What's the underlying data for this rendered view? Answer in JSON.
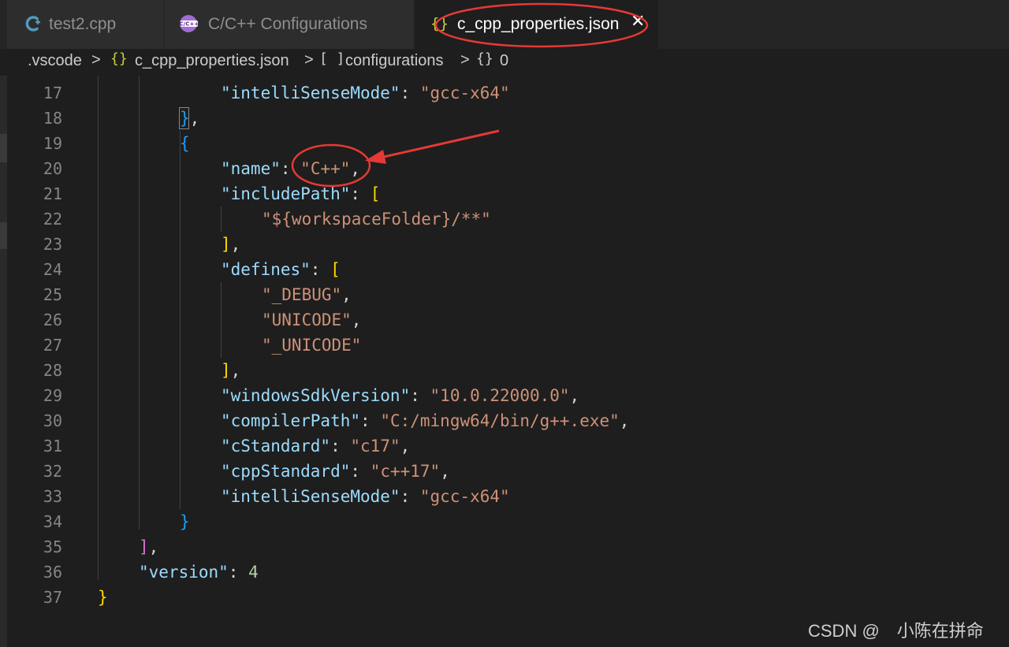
{
  "tabs": [
    {
      "label": "test2.cpp",
      "icon": "cpp-file-icon",
      "active": false
    },
    {
      "label": "C/C++ Configurations",
      "icon": "cpp-extension-icon",
      "icon_text": "C/C++",
      "active": false
    },
    {
      "label": "c_cpp_properties.json",
      "icon": "json-braces-icon",
      "icon_text": "{}",
      "active": true,
      "close": "✕"
    }
  ],
  "breadcrumb": {
    "folder": ".vscode",
    "file": "c_cpp_properties.json",
    "file_icon": "{}",
    "section": "configurations",
    "section_icon": "[ ]",
    "item": "0",
    "item_icon": "{}",
    "sep": ">"
  },
  "editor": {
    "line_numbers": [
      "17",
      "18",
      "19",
      "20",
      "21",
      "22",
      "23",
      "24",
      "25",
      "26",
      "27",
      "28",
      "29",
      "30",
      "31",
      "32",
      "33",
      "34",
      "35",
      "36",
      "37"
    ],
    "code": {
      "l17_key": "\"intelliSenseMode\"",
      "l17_val": "\"gcc-x64\"",
      "l18": "}",
      "l19": "{",
      "l20_key": "\"name\"",
      "l20_val": "\"C++\"",
      "l21_key": "\"includePath\"",
      "l21_br": "[",
      "l22_val": "\"${workspaceFolder}/**\"",
      "l23": "]",
      "l24_key": "\"defines\"",
      "l24_br": "[",
      "l25_val": "\"_DEBUG\"",
      "l26_val": "\"UNICODE\"",
      "l27_val": "\"_UNICODE\"",
      "l28": "]",
      "l29_key": "\"windowsSdkVersion\"",
      "l29_val": "\"10.0.22000.0\"",
      "l30_key": "\"compilerPath\"",
      "l30_val": "\"C:/mingw64/bin/g++.exe\"",
      "l31_key": "\"cStandard\"",
      "l31_val": "\"c17\"",
      "l32_key": "\"cppStandard\"",
      "l32_val": "\"c++17\"",
      "l33_key": "\"intelliSenseMode\"",
      "l33_val": "\"gcc-x64\"",
      "l34": "}",
      "l35": "]",
      "l36_key": "\"version\"",
      "l36_val": "4",
      "l37": "}",
      "colon": ":",
      "comma": ","
    }
  },
  "colors": {
    "key": "#9cdcfe",
    "string": "#ce9178",
    "number": "#b5cea8",
    "bracket_gold": "#ffd700",
    "bracket_pink": "#da70d6",
    "bracket_blue": "#179fff",
    "annotation_red": "#e53935"
  },
  "watermark": "CSDN @　小陈在拼命"
}
